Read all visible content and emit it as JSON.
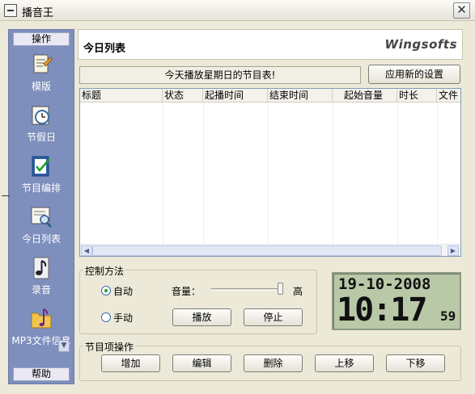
{
  "window": {
    "title": "播音王",
    "close_glyph": "✕"
  },
  "sidebar": {
    "top_header": "操作",
    "bottom_header": "帮助",
    "items": [
      {
        "label": "模版",
        "icon": "template-icon"
      },
      {
        "label": "节假日",
        "icon": "holiday-clock-icon"
      },
      {
        "label": "节目编排",
        "icon": "schedule-edit-icon"
      },
      {
        "label": "今日列表",
        "icon": "today-list-icon"
      },
      {
        "label": "录音",
        "icon": "music-note-icon"
      },
      {
        "label": "MP3文件信息",
        "icon": "mp3-folder-icon"
      }
    ],
    "scroll_glyph": "▼"
  },
  "main": {
    "title": "今日列表",
    "brand": "Wingsofts",
    "notice": "今天播放星期日的节目表!",
    "apply_button": "应用新的设置"
  },
  "table": {
    "columns": [
      "标题",
      "状态",
      "起播时间",
      "结束时间",
      "起始音量",
      "时长",
      "文件"
    ],
    "rows": [],
    "scroll_left": "◀",
    "scroll_right": "▶"
  },
  "control": {
    "group_label": "控制方法",
    "mode_auto": "自动",
    "mode_manual": "手动",
    "selected_mode": "自动",
    "volume_label": "音量：",
    "volume_high": "高",
    "volume_level": 1.0,
    "play_button": "播放",
    "stop_button": "停止"
  },
  "clock": {
    "date": "19-10-2008",
    "time": "10:17",
    "seconds": "59"
  },
  "program_ops": {
    "group_label": "节目项操作",
    "add": "增加",
    "edit": "编辑",
    "delete": "删除",
    "move_up": "上移",
    "move_down": "下移"
  }
}
